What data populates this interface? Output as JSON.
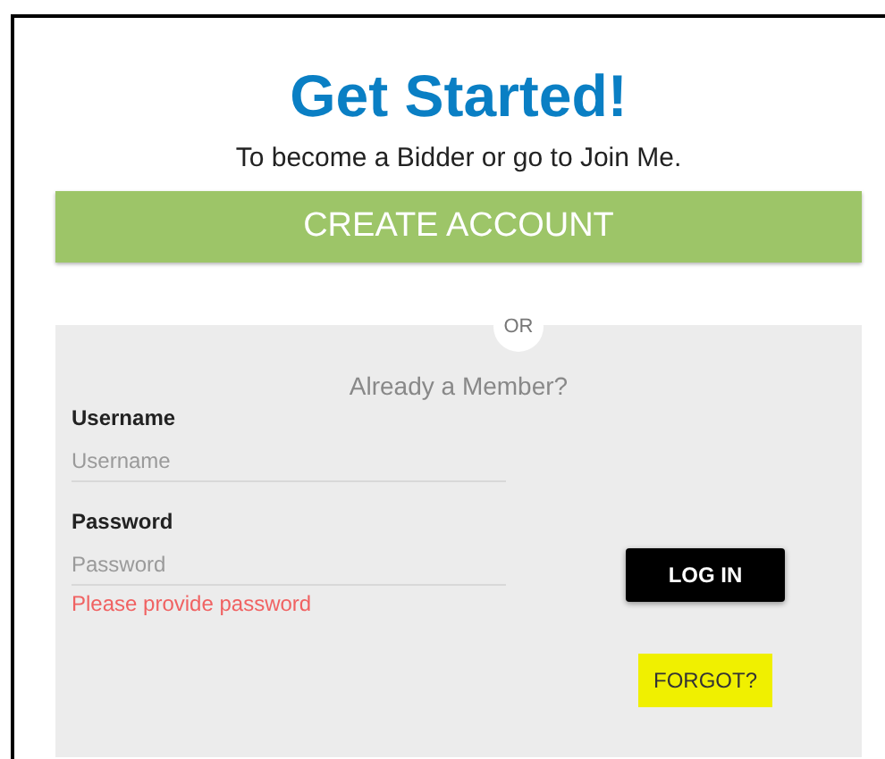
{
  "heading": "Get Started!",
  "subtitle": "To become a Bidder or go to Join Me.",
  "create_account_button": "CREATE ACCOUNT",
  "divider": "OR",
  "login": {
    "title": "Already a Member?",
    "fields": [
      {
        "label": "Username",
        "placeholder": "Username"
      },
      {
        "label": "Password",
        "placeholder": "Password",
        "error": "Please provide password"
      }
    ],
    "login_button": "LOG IN",
    "forgot_link": {
      "label": "FORGOT?",
      "highlighted": true
    }
  }
}
